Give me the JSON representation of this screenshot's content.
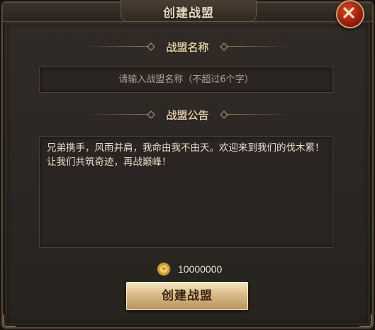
{
  "dialog": {
    "title": "创建战盟",
    "close_icon": "close-x-icon"
  },
  "name_section": {
    "header": "战盟名称",
    "placeholder": "请输入战盟名称（不超过6个字）",
    "value": ""
  },
  "notice_section": {
    "header": "战盟公告",
    "text": "兄弟携手，风雨并肩，我命由我不由天。欢迎来到我们的伐木累！让我们共筑奇迹，再战巅峰！"
  },
  "cost": {
    "icon": "gold-coin-icon",
    "amount": "10000000"
  },
  "create_button": {
    "label": "创建战盟"
  },
  "colors": {
    "panel_bg": "#2b2724",
    "gold_text": "#d9c3a0",
    "button_gold": "#d9bb87",
    "close_red": "#9c1f12"
  }
}
